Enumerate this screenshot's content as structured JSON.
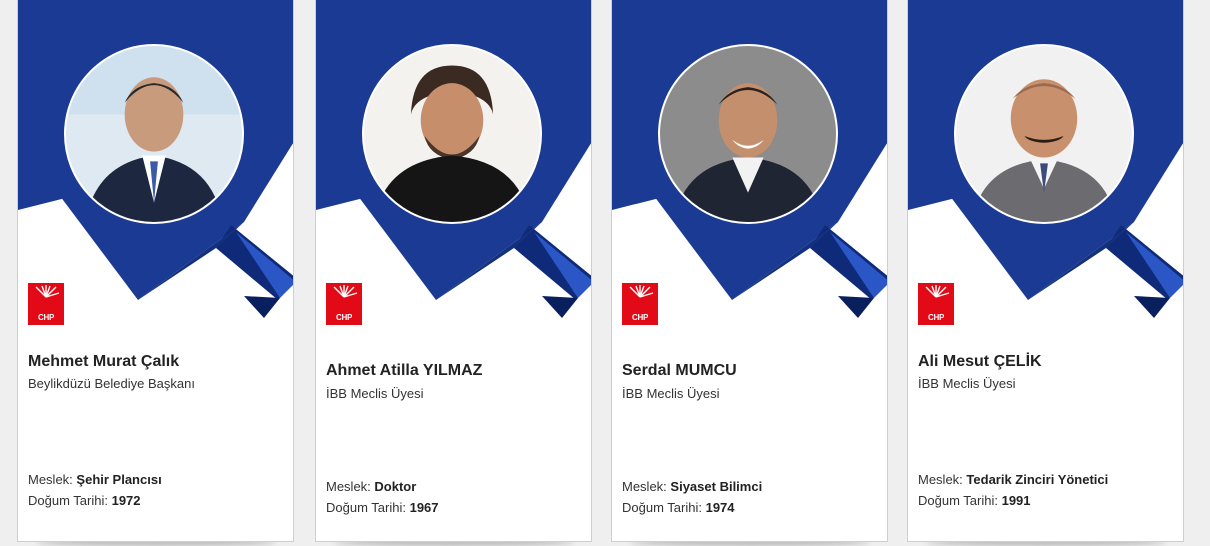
{
  "colors": {
    "brand_blue": "#1b3a93",
    "brand_blue_dark": "#0f2a78",
    "party_red": "#e30a17"
  },
  "logo_text": "CHP",
  "labels": {
    "occupation": "Meslek:",
    "birth_date": "Doğum Tarihi:"
  },
  "cards": [
    {
      "name": "Mehmet Murat Çalık",
      "title": "Beylikdüzü Belediye Başkanı",
      "occupation": "Şehir Plancısı",
      "birth_year": "1972"
    },
    {
      "name": "Ahmet Atilla YILMAZ",
      "title": "İBB Meclis Üyesi",
      "occupation": "Doktor",
      "birth_year": "1967"
    },
    {
      "name": "Serdal MUMCU",
      "title": "İBB Meclis Üyesi",
      "occupation": "Siyaset Bilimci",
      "birth_year": "1974"
    },
    {
      "name": "Ali Mesut ÇELİK",
      "title": "İBB Meclis Üyesi",
      "occupation": "Tedarik Zinciri Yönetici",
      "birth_year": "1991"
    }
  ]
}
